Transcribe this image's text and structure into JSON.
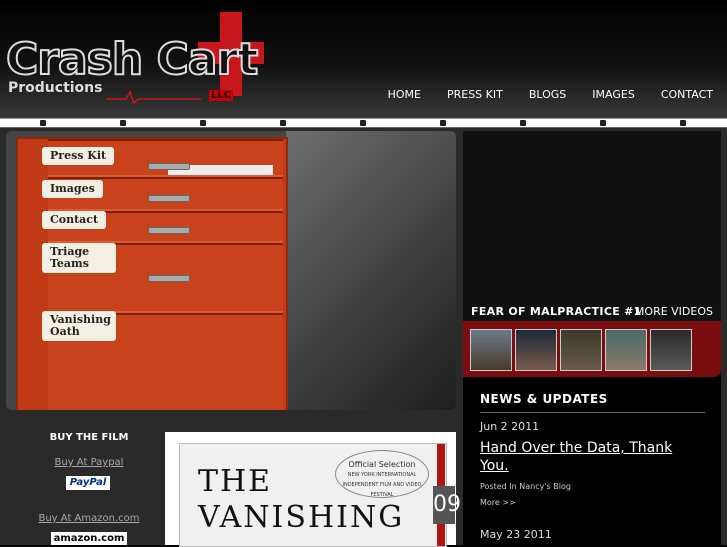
{
  "brand": {
    "name": "Crash Cart",
    "sub": "Productions",
    "llc": "LLC"
  },
  "nav": {
    "items": [
      "HOME",
      "PRESS KIT",
      "BLOGS",
      "IMAGES",
      "CONTACT"
    ]
  },
  "hero": {
    "labels": [
      "Press Kit",
      "Images",
      "Contact",
      "Triage Teams",
      "Vanishing Oath"
    ]
  },
  "video": {
    "title": "FEAR OF MALPRACTICE #1",
    "more": "MORE VIDEOS"
  },
  "news": {
    "heading": "NEWS & UPDATES",
    "items": [
      {
        "date": "Jun 2 2011",
        "title": "Hand Over the Data, Thank You.",
        "posted": "Posted In Nancy's Blog",
        "more": "More >>"
      },
      {
        "date": "May 23 2011"
      }
    ]
  },
  "buy": {
    "title": "BUY THE FILM",
    "paypal_link": "Buy At Paypal",
    "paypal_badge": "PayPal",
    "amazon_link": "Buy At Amazon.com",
    "amazon_badge": "amazon.com"
  },
  "poster": {
    "title_line1": "THE",
    "title_line2": "VANISHING",
    "selection": "Official Selection",
    "festival": "NEW YORK INTERNATIONAL INDEPENDENT FILM AND VIDEO FESTIVAL",
    "number": "09"
  },
  "colors": {
    "brand_red": "#c8161d",
    "cart_red": "#c03a16",
    "thumb_bar": "#7a0d10"
  }
}
